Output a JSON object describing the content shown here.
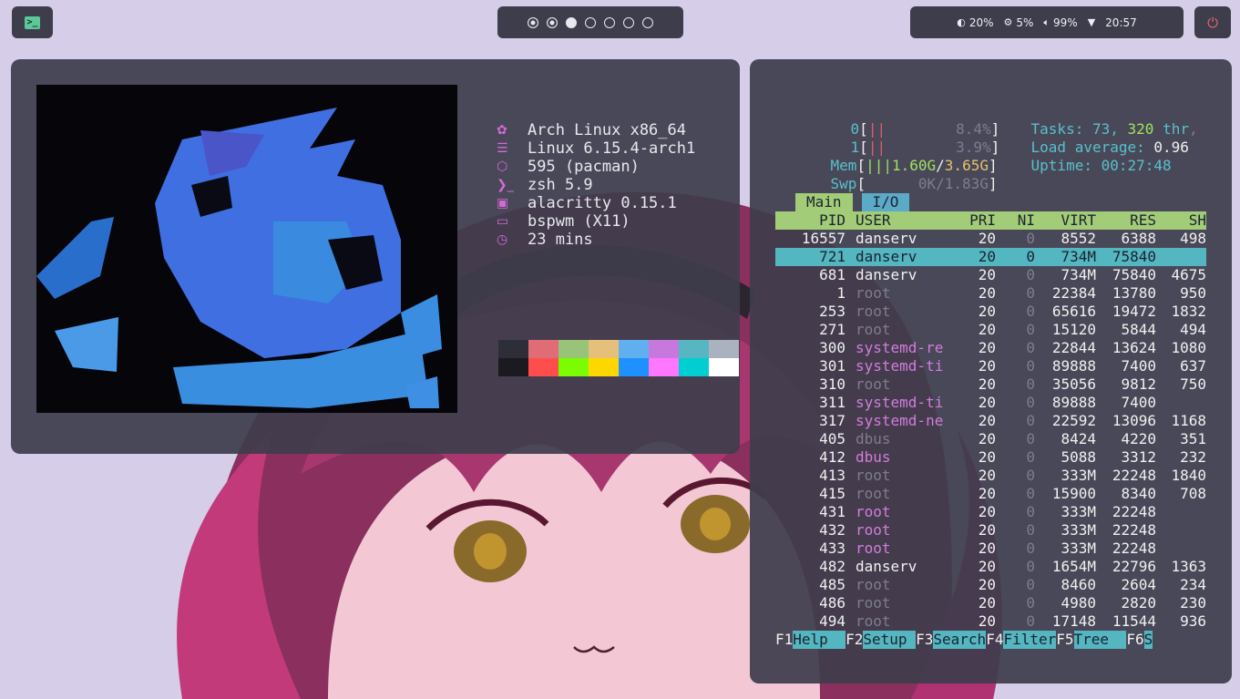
{
  "topbar": {
    "launcher_icon": "terminal-icon",
    "workspaces": [
      {
        "state": "occupied"
      },
      {
        "state": "occupied"
      },
      {
        "state": "active"
      },
      {
        "state": "empty"
      },
      {
        "state": "empty"
      },
      {
        "state": "empty"
      },
      {
        "state": "empty"
      }
    ],
    "status": {
      "brightness": "20%",
      "cpu": "5%",
      "volume": "99%",
      "time": "20:57"
    },
    "power_icon": "power-icon"
  },
  "neofetch": {
    "info": [
      {
        "icon": "gear-icon",
        "glyph": "✿",
        "text": "Arch Linux x86_64"
      },
      {
        "icon": "server-icon",
        "glyph": "☰",
        "text": "Linux 6.15.4-arch1"
      },
      {
        "icon": "package-icon",
        "glyph": "⬡",
        "text": "595 (pacman)"
      },
      {
        "icon": "shell-icon",
        "glyph": "❯_",
        "text": "zsh 5.9"
      },
      {
        "icon": "terminal-icon",
        "glyph": "▣",
        "text": "alacritty 0.15.1"
      },
      {
        "icon": "window-icon",
        "glyph": "▭",
        "text": "bspwm (X11)"
      },
      {
        "icon": "clock-icon",
        "glyph": "◷",
        "text": "23 mins"
      }
    ],
    "palette": [
      "#2e2e38",
      "#e06c75",
      "#98c379",
      "#e5c07b",
      "#61afef",
      "#c678dd",
      "#56b6c2",
      "#abb2bf",
      "#1a1a20",
      "#ff4d4d",
      "#7cfc00",
      "#ffd700",
      "#1e90ff",
      "#ff77ff",
      "#00ced1",
      "#ffffff"
    ]
  },
  "htop": {
    "cpu0": {
      "label": "0",
      "bar": "||",
      "pct": "8.4%"
    },
    "cpu1": {
      "label": "1",
      "bar": "||",
      "pct": "3.9%"
    },
    "mem": {
      "label": "Mem",
      "bar": "|||",
      "used": "1.60G",
      "total": "3.65G"
    },
    "swp": {
      "label": "Swp",
      "used": "0K",
      "total": "1.83G"
    },
    "tasks": {
      "label": "Tasks:",
      "count": "73",
      "threads": "320",
      "thr_label": "thr"
    },
    "load": {
      "label": "Load average:",
      "value": "0.96"
    },
    "uptime": {
      "label": "Uptime:",
      "value": "00:27:48"
    },
    "tabs": [
      "Main",
      "I/O"
    ],
    "columns": [
      "PID",
      "USER",
      "PRI",
      "NI",
      "VIRT",
      "RES",
      "SH"
    ],
    "rows": [
      {
        "pid": "16557",
        "user": "danserv",
        "pri": "20",
        "ni": "0",
        "virt": "8552",
        "res": "6388",
        "sh": "498",
        "ucolor": "white"
      },
      {
        "pid": "721",
        "user": "danserv",
        "pri": "20",
        "ni": "0",
        "virt": "734M",
        "res": "75840",
        "sh": "",
        "ucolor": "sel"
      },
      {
        "pid": "681",
        "user": "danserv",
        "pri": "20",
        "ni": "0",
        "virt": "734M",
        "res": "75840",
        "sh": "4675",
        "ucolor": "white"
      },
      {
        "pid": "1",
        "user": "root",
        "pri": "20",
        "ni": "0",
        "virt": "22384",
        "res": "13780",
        "sh": "950",
        "ucolor": "dim"
      },
      {
        "pid": "253",
        "user": "root",
        "pri": "20",
        "ni": "0",
        "virt": "65616",
        "res": "19472",
        "sh": "1832",
        "ucolor": "dim"
      },
      {
        "pid": "271",
        "user": "root",
        "pri": "20",
        "ni": "0",
        "virt": "15120",
        "res": "5844",
        "sh": "494",
        "ucolor": "dim"
      },
      {
        "pid": "300",
        "user": "systemd-re",
        "pri": "20",
        "ni": "0",
        "virt": "22844",
        "res": "13624",
        "sh": "1080",
        "ucolor": "purple"
      },
      {
        "pid": "301",
        "user": "systemd-ti",
        "pri": "20",
        "ni": "0",
        "virt": "89888",
        "res": "7400",
        "sh": "637",
        "ucolor": "purple"
      },
      {
        "pid": "310",
        "user": "root",
        "pri": "20",
        "ni": "0",
        "virt": "35056",
        "res": "9812",
        "sh": "750",
        "ucolor": "dim"
      },
      {
        "pid": "311",
        "user": "systemd-ti",
        "pri": "20",
        "ni": "0",
        "virt": "89888",
        "res": "7400",
        "sh": "",
        "ucolor": "purple"
      },
      {
        "pid": "317",
        "user": "systemd-ne",
        "pri": "20",
        "ni": "0",
        "virt": "22592",
        "res": "13096",
        "sh": "1168",
        "ucolor": "purple"
      },
      {
        "pid": "405",
        "user": "dbus",
        "pri": "20",
        "ni": "0",
        "virt": "8424",
        "res": "4220",
        "sh": "351",
        "ucolor": "dim"
      },
      {
        "pid": "412",
        "user": "dbus",
        "pri": "20",
        "ni": "0",
        "virt": "5088",
        "res": "3312",
        "sh": "232",
        "ucolor": "purple"
      },
      {
        "pid": "413",
        "user": "root",
        "pri": "20",
        "ni": "0",
        "virt": "333M",
        "res": "22248",
        "sh": "1840",
        "ucolor": "dim"
      },
      {
        "pid": "415",
        "user": "root",
        "pri": "20",
        "ni": "0",
        "virt": "15900",
        "res": "8340",
        "sh": "708",
        "ucolor": "dim"
      },
      {
        "pid": "431",
        "user": "root",
        "pri": "20",
        "ni": "0",
        "virt": "333M",
        "res": "22248",
        "sh": "",
        "ucolor": "purple"
      },
      {
        "pid": "432",
        "user": "root",
        "pri": "20",
        "ni": "0",
        "virt": "333M",
        "res": "22248",
        "sh": "",
        "ucolor": "purple"
      },
      {
        "pid": "433",
        "user": "root",
        "pri": "20",
        "ni": "0",
        "virt": "333M",
        "res": "22248",
        "sh": "",
        "ucolor": "purple"
      },
      {
        "pid": "482",
        "user": "danserv",
        "pri": "20",
        "ni": "0",
        "virt": "1654M",
        "res": "22796",
        "sh": "1363",
        "ucolor": "white"
      },
      {
        "pid": "485",
        "user": "root",
        "pri": "20",
        "ni": "0",
        "virt": "8460",
        "res": "2604",
        "sh": "234",
        "ucolor": "dim"
      },
      {
        "pid": "486",
        "user": "root",
        "pri": "20",
        "ni": "0",
        "virt": "4980",
        "res": "2820",
        "sh": "230",
        "ucolor": "dim"
      },
      {
        "pid": "494",
        "user": "root",
        "pri": "20",
        "ni": "0",
        "virt": "17148",
        "res": "11544",
        "sh": "936",
        "ucolor": "dim"
      }
    ],
    "fkeys": [
      {
        "key": "F1",
        "label": "Help  "
      },
      {
        "key": "F2",
        "label": "Setup "
      },
      {
        "key": "F3",
        "label": "Search"
      },
      {
        "key": "F4",
        "label": "Filter"
      },
      {
        "key": "F5",
        "label": "Tree  "
      },
      {
        "key": "F6",
        "label": "S"
      }
    ]
  }
}
